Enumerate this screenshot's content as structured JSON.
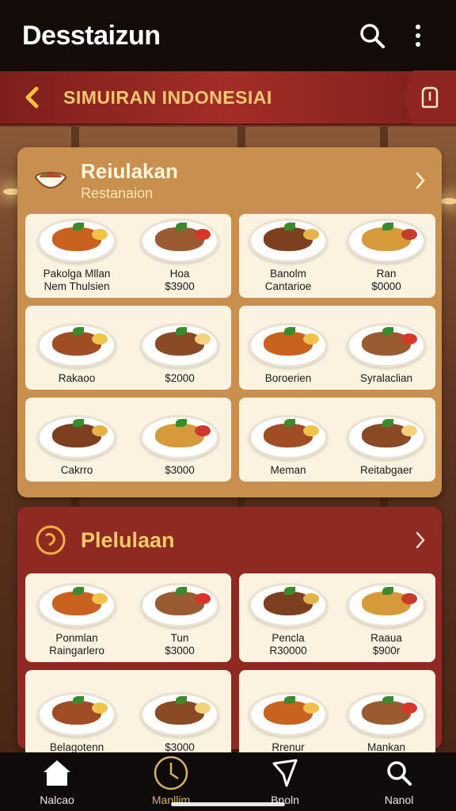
{
  "app": {
    "title": "Desstaizun"
  },
  "header": {
    "title": "SIMUIRAN INDONESIAI"
  },
  "section1": {
    "title": "Reiulakan",
    "subtitle": "Restanaion",
    "tiles": [
      {
        "left": "Pakolga Mllan\nNem Thulsien",
        "right": "Hoa\n$3900"
      },
      {
        "left": "Banolm\nCantarioe",
        "right": "Ran\n$0000"
      },
      {
        "left": "Rakaoo",
        "right": "$2000"
      },
      {
        "left": "Boroerien",
        "right": "Syralaclian"
      },
      {
        "left": "Cakrro",
        "right": "$3000"
      },
      {
        "left": "Meman",
        "right": "Reitabgaer"
      }
    ]
  },
  "section2": {
    "title": "Plelulaan",
    "tiles": [
      {
        "left": "Ponmlan\nRaingarlero",
        "right": "Tun\n$3000"
      },
      {
        "left": "Pencla\nR30000",
        "right": "Raaua\n$900r"
      },
      {
        "left": "Belagotenn",
        "right": "$3000"
      },
      {
        "left": "Rrenur",
        "right": "Mankan"
      }
    ]
  },
  "nav": [
    {
      "label": "Nalcao",
      "icon": "home-icon"
    },
    {
      "label": "Manllim",
      "icon": "clock-icon"
    },
    {
      "label": "Bnoln",
      "icon": "navigation-icon"
    },
    {
      "label": "Nanol",
      "icon": "search-icon"
    }
  ],
  "colors": {
    "accent": "#f3c86e",
    "header": "#a32d27",
    "appbar": "#140c09"
  }
}
